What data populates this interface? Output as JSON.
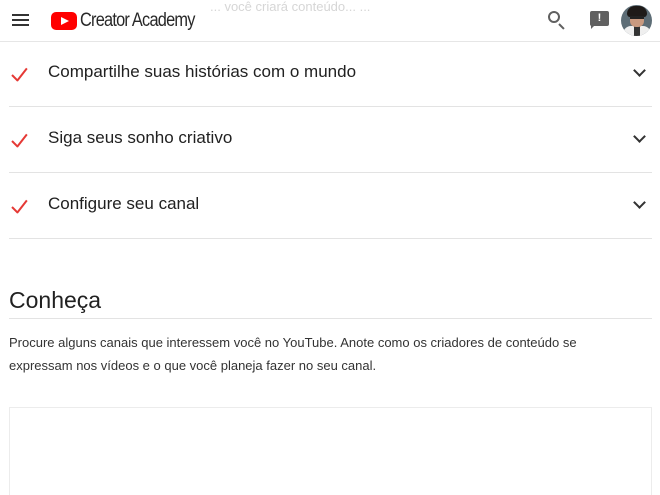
{
  "header": {
    "logo_text": "Creator Academy",
    "icons": [
      "menu-icon",
      "youtube-logo-icon",
      "search-icon",
      "feedback-icon",
      "avatar"
    ]
  },
  "background_text": "... você criará conteúdo... ...",
  "accordion": {
    "items": [
      {
        "label": "Compartilhe suas histórias com o mundo",
        "checked": true
      },
      {
        "label": "Siga seus sonho criativo",
        "checked": true
      },
      {
        "label": "Configure seu canal",
        "checked": true
      }
    ]
  },
  "section": {
    "title": "Conheça",
    "paragraph_line1": "Procure alguns canais que interessem você no YouTube. Anote como os criadores de conteúdo se",
    "paragraph_line2": "expressam nos vídeos e o que você planeja fazer no seu canal."
  },
  "colors": {
    "check": "#e53935",
    "brand_red": "#ff0000",
    "text": "#212121",
    "divider": "#e3e3e3"
  }
}
